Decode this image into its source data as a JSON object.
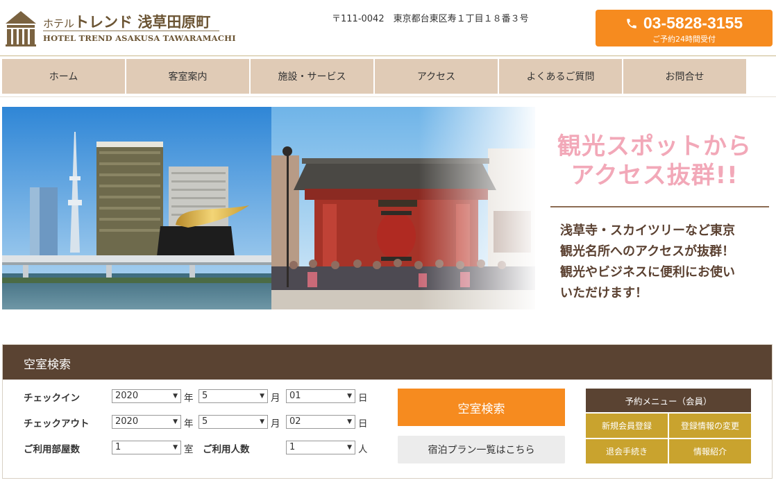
{
  "header": {
    "logo_prefix": "ホテル",
    "logo_name": "トレンド 浅草田原町",
    "logo_en": "HOTEL TREND ASAKUSA TAWARAMACHI",
    "address": "〒111-0042　東京都台東区寿１丁目１８番３号",
    "phone": "03-5828-3155",
    "phone_note": "ご予約24時間受付"
  },
  "nav": {
    "items": [
      {
        "label": "ホーム"
      },
      {
        "label": "客室案内"
      },
      {
        "label": "施設・サービス"
      },
      {
        "label": "アクセス"
      },
      {
        "label": "よくあるご質問"
      },
      {
        "label": "お問合せ"
      }
    ]
  },
  "hero": {
    "headline_1": "観光スポットから",
    "headline_2": "アクセス抜群!!",
    "body_1": "浅草寺・スカイツリーなど東京",
    "body_2": "観光名所へのアクセスが抜群！",
    "body_3": "観光やビジネスに便利にお使い",
    "body_4": "いただけます！"
  },
  "search": {
    "title": "空室検索",
    "checkin_label": "チェックイン",
    "checkout_label": "チェックアウト",
    "rooms_label": "ご利用部屋数",
    "people_label": "ご利用人数",
    "checkin": {
      "year": "2020",
      "month": "5",
      "day": "01"
    },
    "checkout": {
      "year": "2020",
      "month": "5",
      "day": "02"
    },
    "rooms": "1",
    "people": "1",
    "unit_year": "年",
    "unit_month": "月",
    "unit_day": "日",
    "unit_room": "室",
    "unit_person": "人",
    "search_button": "空室検索",
    "plan_button": "宿泊プラン一覧はこちら"
  },
  "member_menu": {
    "title": "予約メニュー（会員）",
    "register": "新規会員登録",
    "change": "登録情報の変更",
    "withdraw": "退会手続き",
    "info": "情報紹介"
  },
  "colors": {
    "brand_brown": "#5a4332",
    "accent_orange": "#f68b1f",
    "nav_beige": "#e0cbb6",
    "gold": "#c9a32e",
    "headline_pink": "#f2a8b8"
  }
}
